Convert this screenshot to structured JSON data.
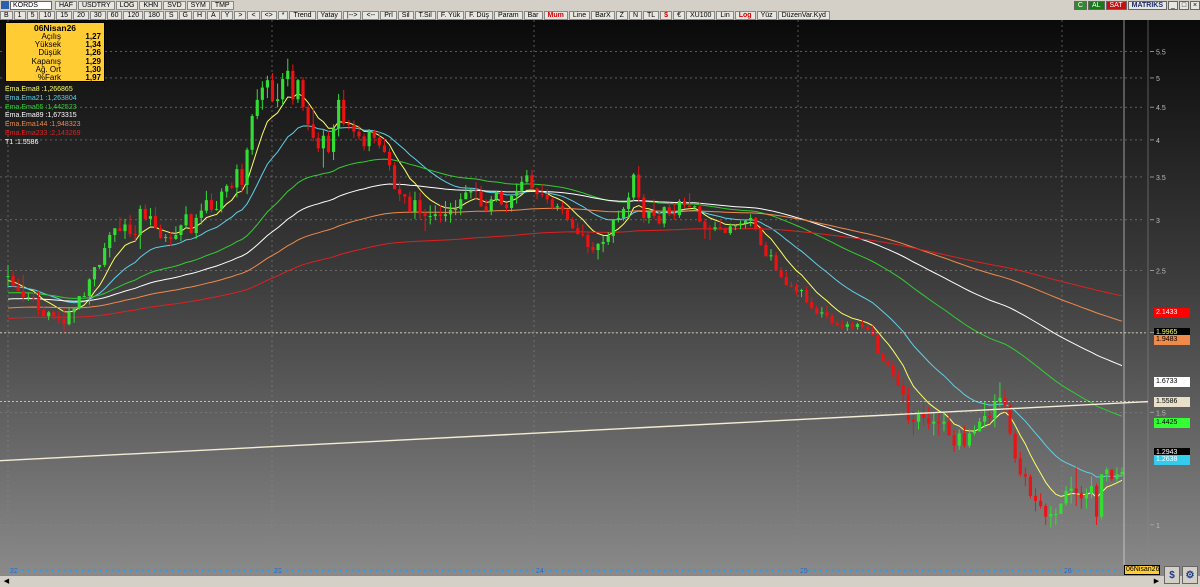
{
  "toolbar": {
    "symbol": "KORDS",
    "items1": [
      "HAF",
      "USDTRY",
      "LOG",
      "KHN",
      "SVD",
      "SYM",
      "TMP"
    ],
    "periods": [
      "B",
      "1",
      "5",
      "10",
      "15",
      "20",
      "30",
      "60",
      "120",
      "180",
      "S",
      "G",
      "H",
      "A",
      "Y"
    ],
    "nav": [
      ">",
      "<",
      "<>",
      "*"
    ],
    "items2": [
      "Trend",
      "Yatay",
      "|-->",
      "<--",
      "Prl",
      "Sil",
      "T.Sil",
      "F. Yük",
      "F. Düş",
      "Param",
      "Bar",
      "Mum",
      "Line",
      "BarX",
      "Z",
      "N",
      "TL",
      "$",
      "€",
      "XU100",
      "Lin",
      "Log",
      "Yüz",
      "DüzenVar.Kyd"
    ],
    "red_items": [
      "Mum",
      "$",
      "Log"
    ],
    "right": {
      "c": "C",
      "al": "AL",
      "sat": "SAT",
      "brand": "MATRIKS"
    }
  },
  "info": {
    "title": "06Nisan26",
    "rows": [
      {
        "label": "Açılış",
        "value": "1,27"
      },
      {
        "label": "Yüksek",
        "value": "1,34"
      },
      {
        "label": "Düşük",
        "value": "1,26"
      },
      {
        "label": "Kapanış",
        "value": "1,29"
      },
      {
        "label": "Ağ. Ort",
        "value": "1,30"
      },
      {
        "label": "%Fark",
        "value": "1,97"
      }
    ]
  },
  "ema_legend": [
    {
      "name": "Ema.Ema8",
      "value": ":1,266865",
      "color": "#ffff66"
    },
    {
      "name": "Ema.Ema21",
      "value": ":1,263804",
      "color": "#5fd0e8"
    },
    {
      "name": "Ema.Ema55",
      "value": ":1,442523",
      "color": "#33cc33"
    },
    {
      "name": "Ema.Ema89",
      "value": ":1,673315",
      "color": "#ffffff"
    },
    {
      "name": "Ema.Ema144",
      "value": ":1,948323",
      "color": "#f08a4b"
    },
    {
      "name": "Ema.Ema233",
      "value": ":2,143269",
      "color": "#e02020"
    },
    {
      "name": "T1",
      "value": ":1.5586",
      "color": "#ffffff"
    }
  ],
  "price_tags": [
    {
      "label": "2.1433",
      "bg": "#ff0000",
      "color": "#ffffff",
      "y": 2.1433
    },
    {
      "label": "1.9965",
      "bg": "#000000",
      "color": "#ffff66",
      "y": 1.9965
    },
    {
      "label": "1.9483",
      "bg": "#f08a4b",
      "color": "#000000",
      "y": 1.9483
    },
    {
      "label": "1.6733",
      "bg": "#ffffff",
      "color": "#000000",
      "y": 1.6733
    },
    {
      "label": "1.5586",
      "bg": "#e8e0c8",
      "color": "#000000",
      "y": 1.5586
    },
    {
      "label": "1.4425",
      "bg": "#33ff33",
      "color": "#000000",
      "y": 1.4425
    },
    {
      "label": "1.2943",
      "bg": "#000000",
      "color": "#ffffff",
      "y": 1.2943
    },
    {
      "label": "1.2638",
      "bg": "#33ccee",
      "color": "#ffffff",
      "y": 1.2638
    }
  ],
  "date_tag": "06Nisan26",
  "chart_data": {
    "type": "candlestick",
    "y_scale": "log",
    "y_ticks": [
      "1",
      "1.5",
      "2",
      "2.5",
      "3",
      "3.5",
      "4",
      "4.5",
      "5",
      "5.5"
    ],
    "x_ticks": [
      "22",
      "23",
      "24",
      "25",
      "26"
    ],
    "colors": {
      "up": "#33dd33",
      "down": "#ee1111"
    },
    "candles": [
      [
        2.45,
        2.55,
        2.35,
        2.45
      ],
      [
        2.45,
        2.5,
        2.36,
        2.36
      ],
      [
        2.36,
        2.43,
        2.32,
        2.32
      ],
      [
        2.32,
        2.46,
        2.23,
        2.27
      ],
      [
        2.27,
        2.31,
        2.24,
        2.27
      ],
      [
        2.27,
        2.31,
        2.23,
        2.26
      ],
      [
        2.26,
        2.32,
        2.13,
        2.17
      ],
      [
        2.17,
        2.2,
        2.1,
        2.12
      ],
      [
        2.12,
        2.16,
        2.09,
        2.15
      ],
      [
        2.15,
        2.16,
        2.09,
        2.12
      ],
      [
        2.12,
        2.16,
        2.06,
        2.1
      ],
      [
        2.1,
        2.18,
        2.0,
        2.06
      ],
      [
        2.06,
        2.19,
        2.05,
        2.15
      ],
      [
        2.15,
        2.18,
        2.07,
        2.18
      ],
      [
        2.18,
        2.28,
        2.17,
        2.28
      ],
      [
        2.28,
        2.31,
        2.27,
        2.28
      ],
      [
        2.28,
        2.43,
        2.21,
        2.42
      ],
      [
        2.42,
        2.53,
        2.36,
        2.53
      ],
      [
        2.53,
        2.55,
        2.51,
        2.55
      ],
      [
        2.55,
        2.76,
        2.53,
        2.71
      ],
      [
        2.71,
        2.87,
        2.62,
        2.84
      ],
      [
        2.84,
        2.91,
        2.77,
        2.91
      ],
      [
        2.91,
        3.03,
        2.88,
        2.88
      ],
      [
        2.88,
        3.01,
        2.8,
        2.95
      ],
      [
        2.95,
        3.05,
        2.82,
        2.85
      ],
      [
        2.85,
        2.94,
        2.78,
        2.84
      ],
      [
        2.84,
        3.16,
        2.7,
        3.12
      ],
      [
        3.12,
        3.17,
        2.99,
        3.01
      ],
      [
        3.01,
        3.13,
        2.94,
        3.04
      ],
      [
        3.04,
        3.14,
        2.91,
        2.91
      ],
      [
        2.91,
        2.95,
        2.8,
        2.81
      ],
      [
        2.81,
        2.85,
        2.77,
        2.82
      ],
      [
        2.82,
        2.87,
        2.73,
        2.8
      ],
      [
        2.8,
        2.93,
        2.79,
        2.84
      ],
      [
        2.84,
        2.95,
        2.78,
        2.94
      ],
      [
        2.94,
        3.15,
        2.91,
        3.06
      ],
      [
        3.06,
        3.07,
        2.85,
        2.86
      ],
      [
        2.86,
        3.06,
        2.8,
        3.02
      ],
      [
        3.02,
        3.18,
        2.95,
        3.1
      ],
      [
        3.1,
        3.33,
        3.07,
        3.22
      ],
      [
        3.22,
        3.3,
        3.08,
        3.11
      ],
      [
        3.11,
        3.21,
        3.1,
        3.12
      ],
      [
        3.12,
        3.36,
        3.08,
        3.32
      ],
      [
        3.32,
        3.41,
        3.25,
        3.39
      ],
      [
        3.39,
        3.43,
        3.35,
        3.37
      ],
      [
        3.37,
        3.66,
        3.25,
        3.6
      ],
      [
        3.6,
        3.67,
        3.31,
        3.4
      ],
      [
        3.4,
        3.89,
        3.29,
        3.86
      ],
      [
        3.86,
        4.39,
        3.79,
        4.36
      ],
      [
        4.36,
        4.8,
        4.31,
        4.62
      ],
      [
        4.62,
        4.94,
        4.46,
        4.83
      ],
      [
        4.83,
        5.04,
        4.65,
        4.96
      ],
      [
        4.96,
        5.09,
        4.58,
        4.6
      ],
      [
        4.6,
        4.9,
        4.5,
        4.63
      ],
      [
        4.63,
        5.09,
        4.53,
        4.98
      ],
      [
        4.98,
        5.36,
        4.85,
        5.13
      ],
      [
        5.13,
        5.25,
        4.54,
        4.63
      ],
      [
        4.63,
        4.98,
        4.57,
        4.96
      ],
      [
        4.96,
        5.01,
        4.44,
        4.5
      ],
      [
        4.5,
        4.54,
        4.14,
        4.23
      ],
      [
        4.23,
        4.49,
        3.98,
        4.03
      ],
      [
        4.03,
        4.11,
        3.83,
        3.88
      ],
      [
        3.88,
        4.16,
        3.62,
        4.06
      ],
      [
        4.06,
        4.13,
        3.81,
        3.83
      ],
      [
        3.83,
        4.23,
        3.72,
        4.17
      ],
      [
        4.17,
        4.72,
        4.05,
        4.62
      ],
      [
        4.62,
        4.79,
        4.21,
        4.24
      ],
      [
        4.24,
        4.3,
        4.15,
        4.22
      ],
      [
        4.22,
        4.29,
        4.03,
        4.12
      ],
      [
        4.12,
        4.21,
        4.0,
        4.05
      ],
      [
        4.05,
        4.09,
        3.85,
        3.91
      ],
      [
        3.91,
        4.16,
        3.84,
        4.13
      ],
      [
        4.13,
        4.15,
        3.95,
        4.03
      ],
      [
        4.03,
        4.12,
        3.88,
        3.92
      ],
      [
        3.92,
        4.02,
        3.82,
        3.83
      ],
      [
        3.83,
        3.88,
        3.58,
        3.65
      ],
      [
        3.65,
        3.69,
        3.35,
        3.35
      ],
      [
        3.35,
        3.44,
        3.21,
        3.29
      ],
      [
        3.29,
        3.29,
        3.18,
        3.26
      ],
      [
        3.26,
        3.32,
        3.08,
        3.09
      ],
      [
        3.09,
        3.32,
        3.01,
        3.22
      ],
      [
        3.22,
        3.31,
        3.01,
        3.07
      ],
      [
        3.07,
        3.12,
        2.88,
        3.04
      ],
      [
        3.04,
        3.16,
        2.95,
        3.04
      ],
      [
        3.04,
        3.16,
        3.0,
        3.06
      ],
      [
        3.06,
        3.16,
        2.97,
        3.04
      ],
      [
        3.04,
        3.21,
        2.98,
        3.06
      ],
      [
        3.06,
        3.19,
        2.97,
        3.11
      ],
      [
        3.11,
        3.22,
        3.05,
        3.12
      ],
      [
        3.12,
        3.3,
        3.05,
        3.23
      ],
      [
        3.23,
        3.4,
        3.23,
        3.31
      ],
      [
        3.31,
        3.36,
        3.24,
        3.33
      ],
      [
        3.33,
        3.44,
        3.22,
        3.32
      ],
      [
        3.32,
        3.39,
        3.14,
        3.15
      ],
      [
        3.15,
        3.23,
        3.08,
        3.1
      ],
      [
        3.1,
        3.27,
        3.05,
        3.23
      ],
      [
        3.23,
        3.33,
        3.2,
        3.32
      ],
      [
        3.32,
        3.34,
        3.16,
        3.17
      ],
      [
        3.17,
        3.19,
        3.08,
        3.13
      ],
      [
        3.13,
        3.28,
        3.09,
        3.27
      ],
      [
        3.27,
        3.42,
        3.18,
        3.33
      ],
      [
        3.33,
        3.51,
        3.29,
        3.44
      ],
      [
        3.44,
        3.59,
        3.42,
        3.52
      ],
      [
        3.52,
        3.59,
        3.34,
        3.36
      ],
      [
        3.36,
        3.37,
        3.23,
        3.29
      ],
      [
        3.29,
        3.41,
        3.25,
        3.28
      ],
      [
        3.28,
        3.35,
        3.18,
        3.23
      ],
      [
        3.23,
        3.25,
        3.11,
        3.14
      ],
      [
        3.14,
        3.18,
        3.1,
        3.15
      ],
      [
        3.15,
        3.2,
        3.06,
        3.11
      ],
      [
        3.11,
        3.12,
        2.98,
        3.0
      ],
      [
        3.0,
        3.03,
        2.9,
        2.91
      ],
      [
        2.91,
        2.97,
        2.84,
        2.85
      ],
      [
        2.85,
        2.95,
        2.82,
        2.84
      ],
      [
        2.84,
        2.86,
        2.66,
        2.72
      ],
      [
        2.72,
        2.77,
        2.66,
        2.69
      ],
      [
        2.69,
        2.76,
        2.6,
        2.75
      ],
      [
        2.75,
        2.83,
        2.67,
        2.77
      ],
      [
        2.77,
        2.87,
        2.74,
        2.83
      ],
      [
        2.83,
        3.01,
        2.76,
        3.0
      ],
      [
        3.0,
        3.1,
        2.97,
        3.02
      ],
      [
        3.02,
        3.14,
        2.99,
        3.12
      ],
      [
        3.12,
        3.31,
        3.02,
        3.25
      ],
      [
        3.25,
        3.55,
        3.21,
        3.53
      ],
      [
        3.53,
        3.64,
        3.21,
        3.25
      ],
      [
        3.25,
        3.29,
        2.97,
        3.02
      ],
      [
        3.02,
        3.1,
        2.96,
        3.1
      ],
      [
        3.1,
        3.23,
        3.01,
        3.04
      ],
      [
        3.04,
        3.08,
        2.95,
        2.96
      ],
      [
        2.96,
        3.15,
        2.92,
        3.14
      ],
      [
        3.14,
        3.19,
        3.04,
        3.06
      ],
      [
        3.06,
        3.18,
        3.0,
        3.05
      ],
      [
        3.05,
        3.23,
        3.02,
        3.21
      ],
      [
        3.21,
        3.25,
        3.13,
        3.16
      ],
      [
        3.16,
        3.3,
        3.14,
        3.14
      ],
      [
        3.14,
        3.16,
        3.1,
        3.15
      ],
      [
        3.15,
        3.19,
        2.97,
        2.98
      ],
      [
        2.98,
        3.01,
        2.8,
        2.91
      ],
      [
        2.91,
        2.94,
        2.79,
        2.9
      ],
      [
        2.9,
        2.98,
        2.88,
        2.92
      ],
      [
        2.92,
        3.0,
        2.89,
        2.91
      ],
      [
        2.91,
        2.92,
        2.86,
        2.86
      ],
      [
        2.86,
        2.96,
        2.84,
        2.93
      ],
      [
        2.93,
        2.95,
        2.89,
        2.94
      ],
      [
        2.94,
        2.99,
        2.9,
        2.96
      ],
      [
        2.96,
        3.0,
        2.91,
        2.99
      ],
      [
        2.99,
        3.06,
        2.93,
        3.02
      ],
      [
        3.02,
        3.03,
        2.88,
        2.91
      ],
      [
        2.91,
        2.93,
        2.73,
        2.74
      ],
      [
        2.74,
        2.77,
        2.63,
        2.63
      ],
      [
        2.63,
        2.7,
        2.59,
        2.64
      ],
      [
        2.64,
        2.67,
        2.5,
        2.5
      ],
      [
        2.5,
        2.53,
        2.43,
        2.44
      ],
      [
        2.44,
        2.49,
        2.37,
        2.37
      ],
      [
        2.37,
        2.4,
        2.35,
        2.36
      ],
      [
        2.36,
        2.39,
        2.29,
        2.32
      ],
      [
        2.32,
        2.34,
        2.27,
        2.33
      ],
      [
        2.33,
        2.36,
        2.22,
        2.23
      ],
      [
        2.23,
        2.27,
        2.18,
        2.18
      ],
      [
        2.18,
        2.2,
        2.13,
        2.14
      ],
      [
        2.14,
        2.19,
        2.11,
        2.15
      ],
      [
        2.15,
        2.2,
        2.1,
        2.12
      ],
      [
        2.12,
        2.14,
        2.05,
        2.07
      ],
      [
        2.07,
        2.09,
        2.05,
        2.05
      ],
      [
        2.05,
        2.09,
        2.02,
        2.04
      ],
      [
        2.04,
        2.08,
        2.01,
        2.06
      ],
      [
        2.06,
        2.08,
        2.02,
        2.04
      ],
      [
        2.04,
        2.07,
        2.02,
        2.06
      ],
      [
        2.06,
        2.09,
        2.03,
        2.04
      ],
      [
        2.04,
        2.06,
        2.0,
        2.02
      ],
      [
        2.02,
        2.05,
        1.98,
        1.98
      ],
      [
        1.98,
        1.99,
        1.85,
        1.85
      ],
      [
        1.85,
        1.86,
        1.8,
        1.8
      ],
      [
        1.8,
        1.82,
        1.76,
        1.78
      ],
      [
        1.78,
        1.81,
        1.69,
        1.71
      ],
      [
        1.71,
        1.75,
        1.65,
        1.65
      ],
      [
        1.65,
        1.7,
        1.55,
        1.6
      ],
      [
        1.6,
        1.64,
        1.44,
        1.46
      ],
      [
        1.46,
        1.5,
        1.38,
        1.45
      ],
      [
        1.45,
        1.51,
        1.41,
        1.49
      ],
      [
        1.49,
        1.54,
        1.43,
        1.47
      ],
      [
        1.47,
        1.53,
        1.41,
        1.44
      ],
      [
        1.44,
        1.5,
        1.38,
        1.45
      ],
      [
        1.45,
        1.5,
        1.38,
        1.44
      ],
      [
        1.44,
        1.5,
        1.4,
        1.45
      ],
      [
        1.45,
        1.49,
        1.38,
        1.38
      ],
      [
        1.38,
        1.41,
        1.3,
        1.33
      ],
      [
        1.33,
        1.41,
        1.31,
        1.39
      ],
      [
        1.39,
        1.43,
        1.32,
        1.33
      ],
      [
        1.33,
        1.41,
        1.32,
        1.39
      ],
      [
        1.39,
        1.43,
        1.38,
        1.4
      ],
      [
        1.4,
        1.47,
        1.4,
        1.45
      ],
      [
        1.45,
        1.56,
        1.42,
        1.48
      ],
      [
        1.48,
        1.51,
        1.44,
        1.47
      ],
      [
        1.47,
        1.6,
        1.42,
        1.56
      ],
      [
        1.56,
        1.67,
        1.53,
        1.58
      ],
      [
        1.58,
        1.63,
        1.5,
        1.54
      ],
      [
        1.54,
        1.55,
        1.38,
        1.39
      ],
      [
        1.39,
        1.41,
        1.25,
        1.27
      ],
      [
        1.27,
        1.3,
        1.19,
        1.2
      ],
      [
        1.2,
        1.23,
        1.15,
        1.19
      ],
      [
        1.19,
        1.2,
        1.1,
        1.11
      ],
      [
        1.11,
        1.14,
        1.05,
        1.09
      ],
      [
        1.09,
        1.12,
        1.06,
        1.07
      ],
      [
        1.07,
        1.08,
        1.0,
        1.03
      ],
      [
        1.03,
        1.07,
        0.99,
        1.04
      ],
      [
        1.04,
        1.06,
        1.0,
        1.04
      ],
      [
        1.04,
        1.08,
        1.04,
        1.08
      ],
      [
        1.08,
        1.15,
        1.07,
        1.13
      ],
      [
        1.13,
        1.19,
        1.08,
        1.14
      ],
      [
        1.14,
        1.23,
        1.07,
        1.12
      ],
      [
        1.12,
        1.15,
        1.06,
        1.1
      ],
      [
        1.1,
        1.14,
        1.06,
        1.12
      ],
      [
        1.12,
        1.19,
        1.1,
        1.15
      ],
      [
        1.15,
        1.16,
        1.0,
        1.03
      ],
      [
        1.03,
        1.2,
        1.02,
        1.2
      ],
      [
        1.2,
        1.23,
        1.17,
        1.22
      ],
      [
        1.22,
        1.22,
        1.17,
        1.18
      ],
      [
        1.18,
        1.23,
        1.17,
        1.2
      ],
      [
        1.2,
        1.23,
        1.19,
        1.21
      ]
    ],
    "ema_periods": [
      8,
      21,
      55,
      89,
      144,
      233
    ],
    "trendline": {
      "start": 1.26,
      "end": 1.5586
    },
    "h_lines": [
      1.9965,
      1.5586
    ]
  }
}
